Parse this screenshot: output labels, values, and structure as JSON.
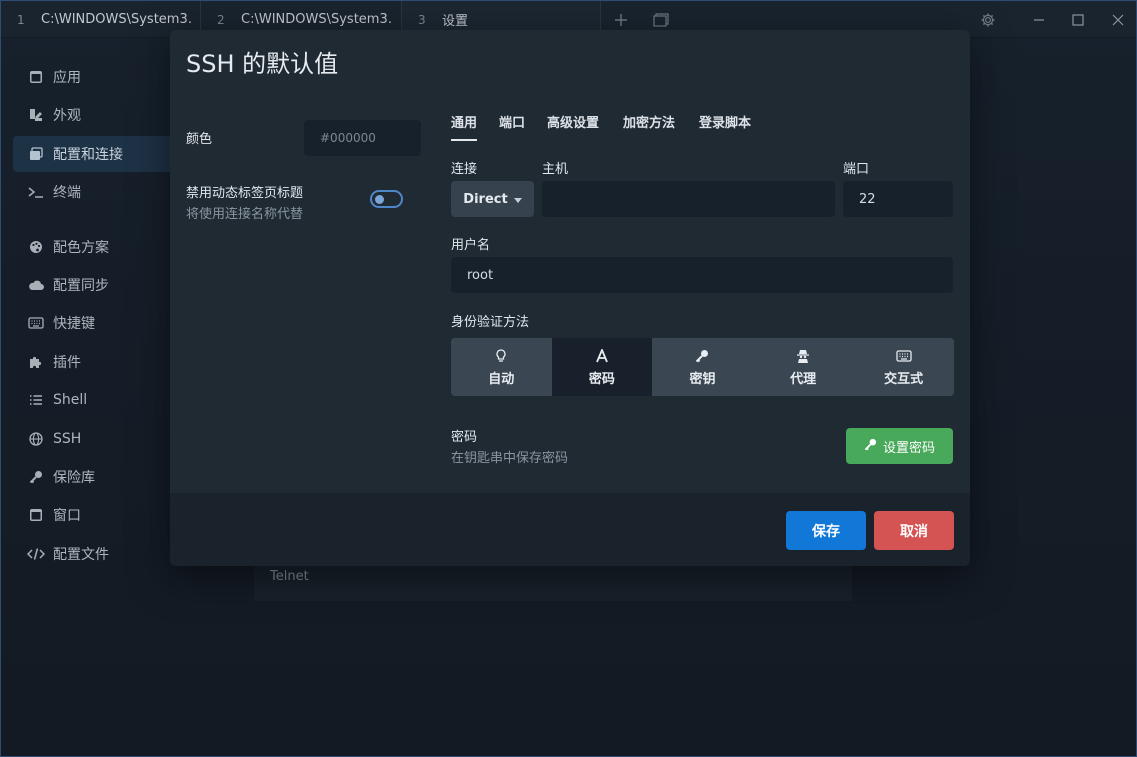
{
  "titlebar": {
    "tabs": [
      {
        "num": "1",
        "label": "C:\\WINDOWS\\System3…"
      },
      {
        "num": "2",
        "label": "C:\\WINDOWS\\System3…"
      },
      {
        "num": "3",
        "label": "设置"
      }
    ]
  },
  "nav": {
    "items": [
      {
        "label": "应用",
        "icon": "app-window-icon"
      },
      {
        "label": "外观",
        "icon": "paint-icon"
      },
      {
        "label": "配置和连接",
        "icon": "profiles-icon"
      },
      {
        "label": "终端",
        "icon": "terminal-icon"
      },
      {
        "label": "配色方案",
        "icon": "palette-icon"
      },
      {
        "label": "配置同步",
        "icon": "cloud-icon"
      },
      {
        "label": "快捷键",
        "icon": "keyboard-icon"
      },
      {
        "label": "插件",
        "icon": "puzzle-icon"
      },
      {
        "label": "Shell",
        "icon": "list-icon"
      },
      {
        "label": "SSH",
        "icon": "globe-icon"
      },
      {
        "label": "保险库",
        "icon": "key-icon"
      },
      {
        "label": "窗口",
        "icon": "window-icon"
      },
      {
        "label": "配置文件",
        "icon": "code-icon"
      }
    ],
    "active": "配置和连接"
  },
  "background": {
    "telnet_label": "Telnet"
  },
  "modal": {
    "title": "SSH 的默认值",
    "color_label": "颜色",
    "color_placeholder": "#000000",
    "dynamic_title_label": "禁用动态标签页标题",
    "dynamic_title_sub": "将使用连接名称代替",
    "dynamic_title_enabled": false,
    "tabs": [
      "通用",
      "端口",
      "高级设置",
      "加密方法",
      "登录脚本"
    ],
    "active_tab": "通用",
    "connection_label": "连接",
    "connection_value": "Direct",
    "host_label": "主机",
    "host_value": "",
    "port_label": "端口",
    "port_value": "22",
    "username_label": "用户名",
    "username_value": "root",
    "auth_label": "身份验证方法",
    "auth_methods": [
      {
        "label": "自动",
        "icon": "lightbulb-icon"
      },
      {
        "label": "密码",
        "icon": "font-a-icon"
      },
      {
        "label": "密钥",
        "icon": "key-icon"
      },
      {
        "label": "代理",
        "icon": "user-secret-icon"
      },
      {
        "label": "交互式",
        "icon": "keyboard-icon"
      }
    ],
    "active_auth": "密码",
    "password_label": "密码",
    "password_sub": "在钥匙串中保存密码",
    "set_password_label": "设置密码",
    "save_label": "保存",
    "cancel_label": "取消"
  },
  "colors": {
    "accent_blue": "#1178d8",
    "danger_red": "#d45454",
    "success_green": "#48a95a"
  }
}
